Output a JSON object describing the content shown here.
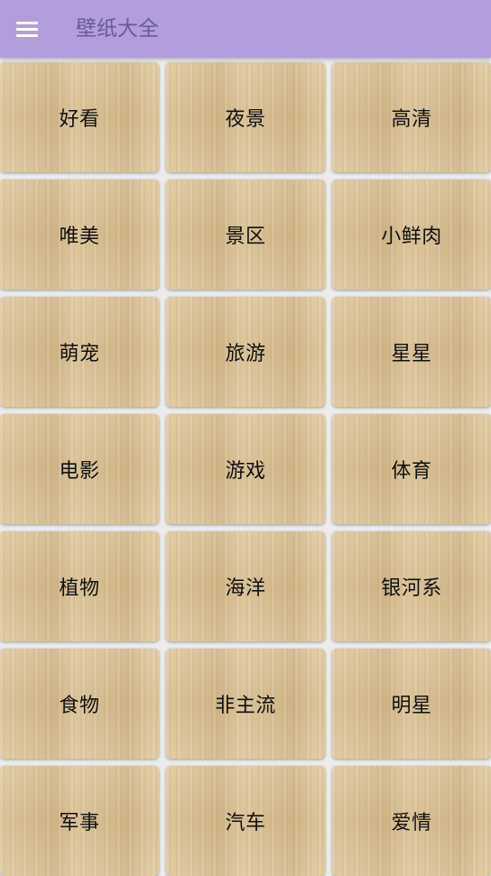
{
  "app_bar": {
    "title": "壁纸大全",
    "menu_icon": "hamburger-menu-icon"
  },
  "categories": [
    "好看",
    "夜景",
    "高清",
    "唯美",
    "景区",
    "小鲜肉",
    "萌宠",
    "旅游",
    "星星",
    "电影",
    "游戏",
    "体育",
    "植物",
    "海洋",
    "银河系",
    "食物",
    "非主流",
    "明星",
    "军事",
    "汽车",
    "爱情"
  ],
  "colors": {
    "app_bar": "#b39ddb",
    "title": "#6a5a93",
    "tile_wood": "#d8c096"
  }
}
